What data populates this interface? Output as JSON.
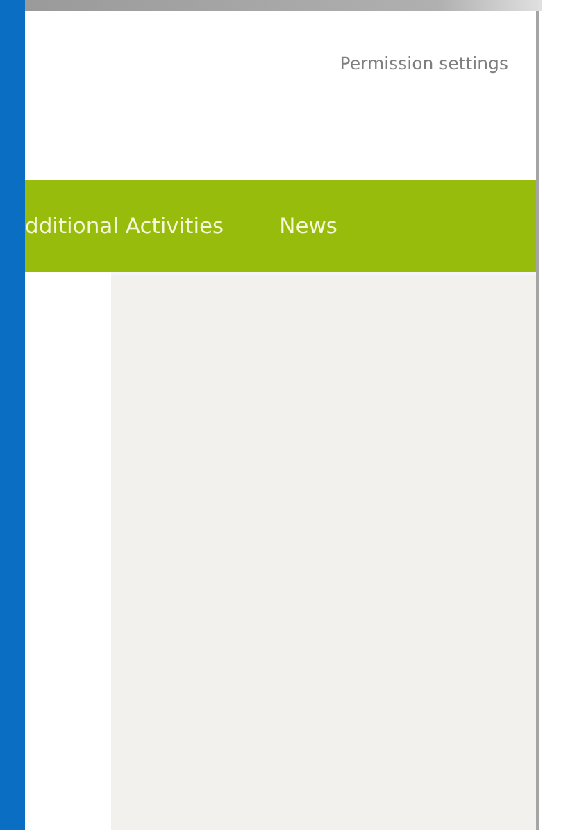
{
  "header": {
    "permission_link": "Permission settings"
  },
  "nav": {
    "items": [
      {
        "label": "dditional Activities"
      },
      {
        "label": "News"
      }
    ]
  }
}
